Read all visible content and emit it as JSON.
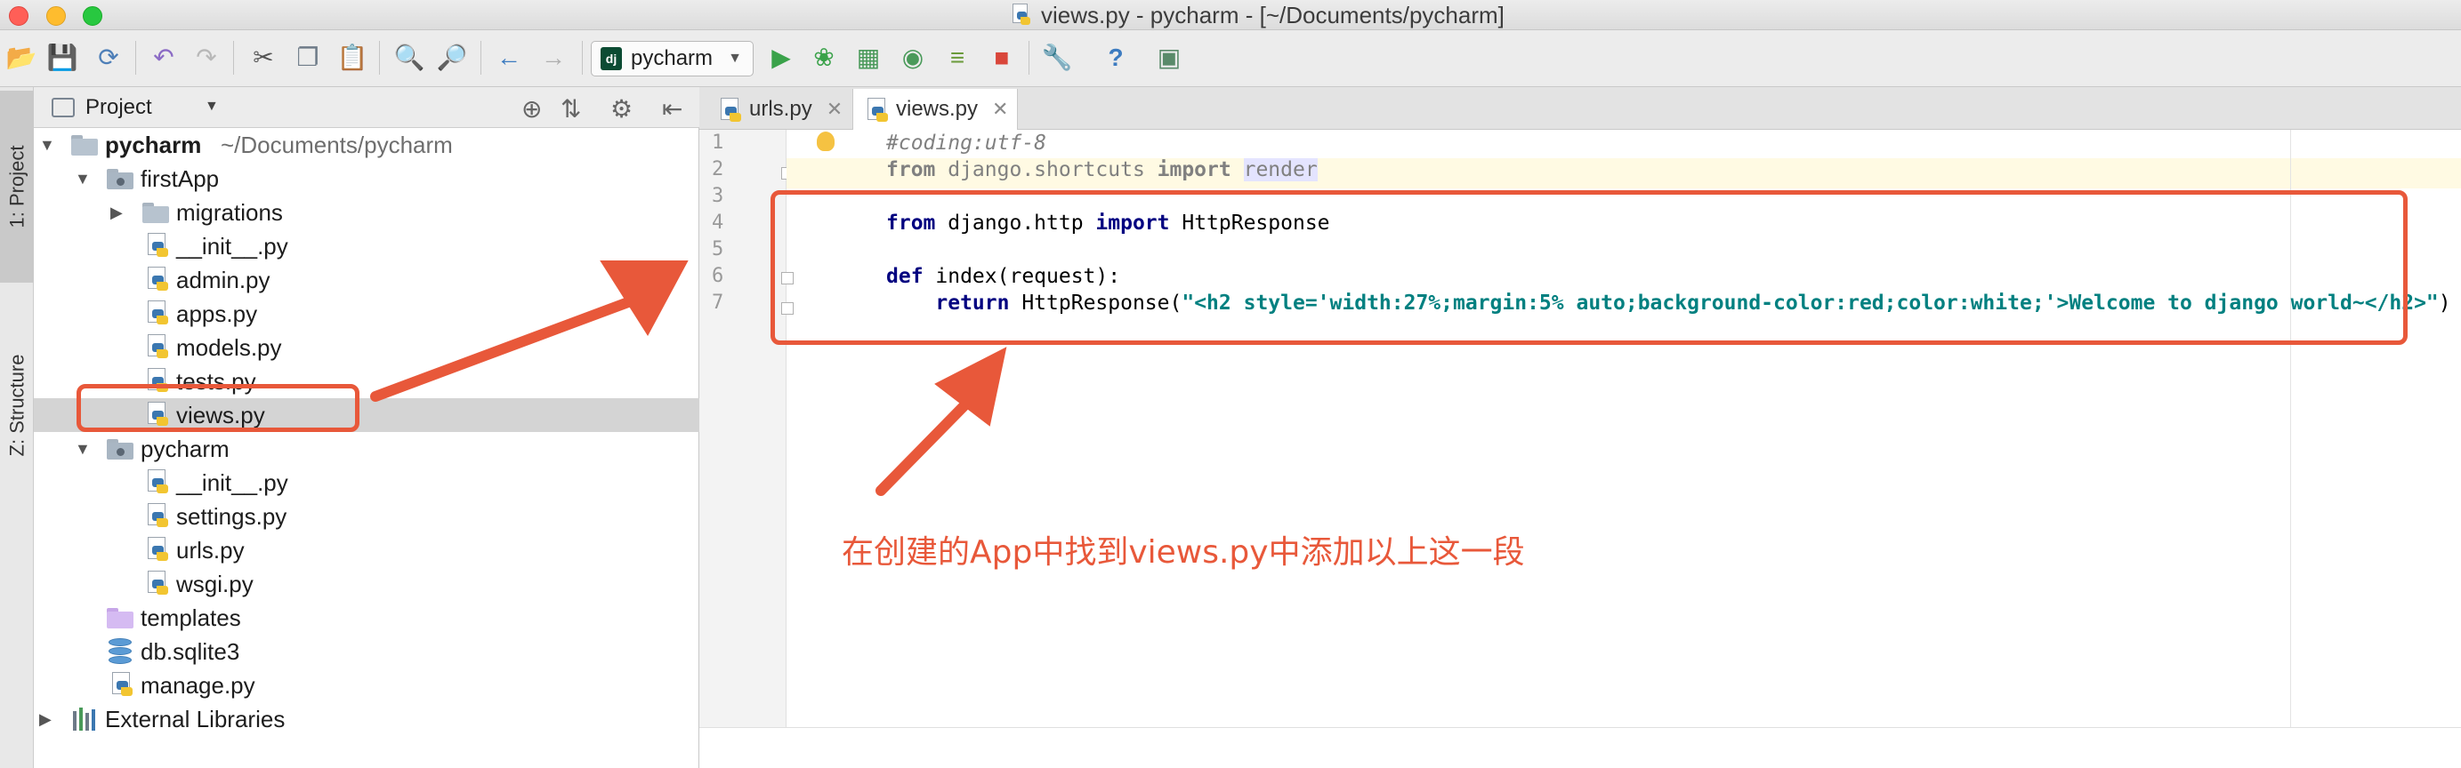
{
  "window": {
    "title": "views.py - pycharm - [~/Documents/pycharm]"
  },
  "toolbar": {
    "run_config": "pycharm",
    "icons": [
      "open-folder-icon",
      "save-icon",
      "sync-icon",
      "undo-icon",
      "redo-icon",
      "cut-icon",
      "copy-icon",
      "paste-icon",
      "find-icon",
      "replace-icon",
      "back-icon",
      "forward-icon",
      "run-icon",
      "debug-icon",
      "coverage-icon",
      "profile-icon",
      "concurrency-icon",
      "stop-icon",
      "settings-wrench-icon",
      "help-icon",
      "sdk-icon"
    ]
  },
  "tool_strip": {
    "project_tab": "1: Project",
    "structure_tab": "Z: Structure"
  },
  "project_panel": {
    "header": "Project",
    "tree": [
      {
        "label": "pycharm",
        "path": "~/Documents/pycharm",
        "kind": "root"
      },
      {
        "label": "firstApp",
        "kind": "module"
      },
      {
        "label": "migrations",
        "kind": "folder"
      },
      {
        "label": "__init__.py",
        "kind": "py"
      },
      {
        "label": "admin.py",
        "kind": "py"
      },
      {
        "label": "apps.py",
        "kind": "py"
      },
      {
        "label": "models.py",
        "kind": "py"
      },
      {
        "label": "tests.py",
        "kind": "py"
      },
      {
        "label": "views.py",
        "kind": "py",
        "selected": true
      },
      {
        "label": "pycharm",
        "kind": "module"
      },
      {
        "label": "__init__.py",
        "kind": "py"
      },
      {
        "label": "settings.py",
        "kind": "py"
      },
      {
        "label": "urls.py",
        "kind": "py"
      },
      {
        "label": "wsgi.py",
        "kind": "py"
      },
      {
        "label": "templates",
        "kind": "templates"
      },
      {
        "label": "db.sqlite3",
        "kind": "db"
      },
      {
        "label": "manage.py",
        "kind": "py"
      },
      {
        "label": "External Libraries",
        "kind": "lib"
      }
    ]
  },
  "editor": {
    "tabs": [
      {
        "label": "urls.py",
        "active": false
      },
      {
        "label": "views.py",
        "active": true
      }
    ],
    "line_numbers": [
      "1",
      "2",
      "3",
      "4",
      "5",
      "6",
      "7"
    ],
    "lines": {
      "l1_comment": "#coding:utf-8",
      "l2_from": "from",
      "l2_module": " django.shortcuts ",
      "l2_import": "import",
      "l2_name": "render",
      "l4_from": "from",
      "l4_module": " django.http ",
      "l4_import": "import",
      "l4_name": " HttpResponse",
      "l6_def": "def",
      "l6_rest": " index(request):",
      "l7_indent": "    ",
      "l7_return": "return",
      "l7_call": " HttpResponse(",
      "l7_string": "\"<h2 style='width:27%;margin:5% auto;background-color:red;color:white;'>Welcome to django world~</h2>\"",
      "l7_close": ")"
    }
  },
  "annotation": {
    "note": "在创建的App中找到views.py中添加以上这一段",
    "color": "#e8583a"
  }
}
